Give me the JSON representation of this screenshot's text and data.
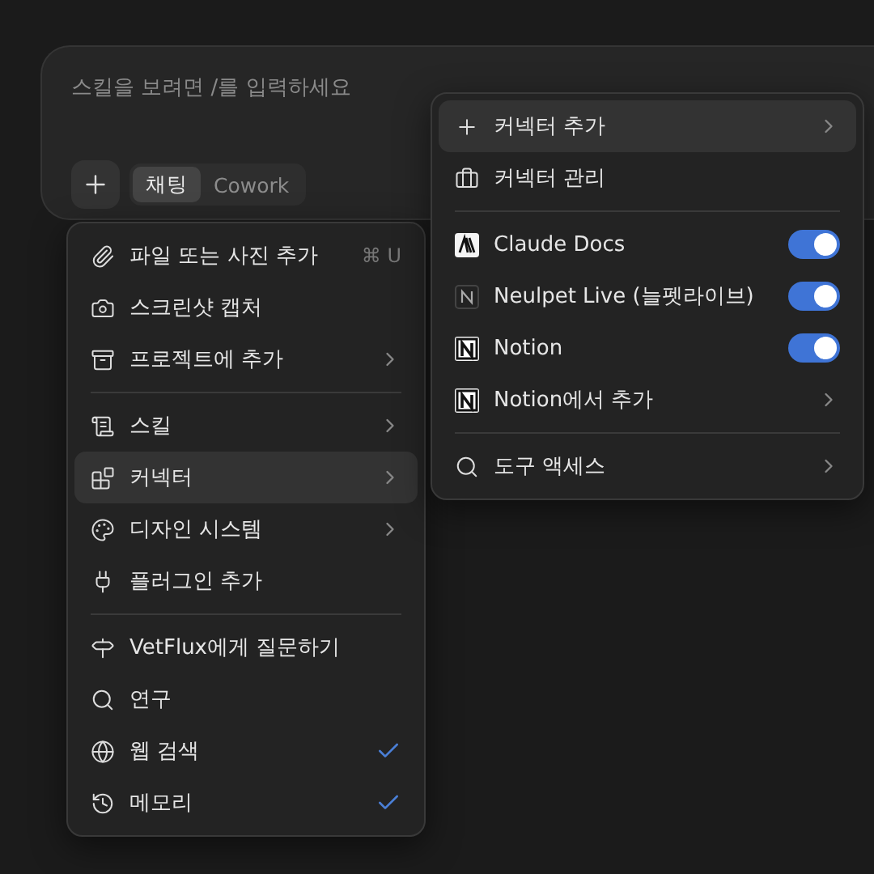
{
  "composer": {
    "placeholder": "스킬을 보려면 /를 입력하세요",
    "modes": [
      {
        "label": "채팅",
        "selected": true
      },
      {
        "label": "Cowork",
        "selected": false
      }
    ]
  },
  "menu": {
    "sections": [
      [
        {
          "label": "파일 또는 사진 추가",
          "kind": "plain",
          "shortcut": "⌘ U",
          "selected": false
        },
        {
          "label": "스크린샷 캡처",
          "kind": "plain",
          "selected": false
        },
        {
          "label": "프로젝트에 추가",
          "kind": "submenu",
          "selected": false
        }
      ],
      [
        {
          "label": "스킬",
          "kind": "submenu",
          "selected": false
        },
        {
          "label": "커넥터",
          "kind": "submenu",
          "selected": true
        },
        {
          "label": "디자인 시스템",
          "kind": "submenu",
          "selected": false
        },
        {
          "label": "플러그인 추가",
          "kind": "plain",
          "selected": false
        }
      ],
      [
        {
          "label": "VetFlux에게 질문하기",
          "kind": "plain",
          "selected": false
        },
        {
          "label": "연구",
          "kind": "plain",
          "selected": false
        },
        {
          "label": "웹 검색",
          "kind": "check",
          "checked": true,
          "selected": false
        },
        {
          "label": "메모리",
          "kind": "check",
          "checked": true,
          "selected": false
        }
      ]
    ]
  },
  "submenu": {
    "sections": [
      [
        {
          "label": "커넥터 추가",
          "kind": "submenu",
          "selected": true
        },
        {
          "label": "커넥터 관리",
          "kind": "plain",
          "selected": false
        }
      ],
      [
        {
          "label": "Claude Docs",
          "kind": "toggle",
          "on": true,
          "selected": false
        },
        {
          "label": "Neulpet Live (늘펫라이브)",
          "kind": "toggle",
          "on": true,
          "selected": false
        },
        {
          "label": "Notion",
          "kind": "toggle",
          "on": true,
          "selected": false
        },
        {
          "label": "Notion에서 추가",
          "kind": "submenu",
          "selected": false
        }
      ],
      [
        {
          "label": "도구 액세스",
          "kind": "submenu",
          "selected": false
        }
      ]
    ]
  }
}
